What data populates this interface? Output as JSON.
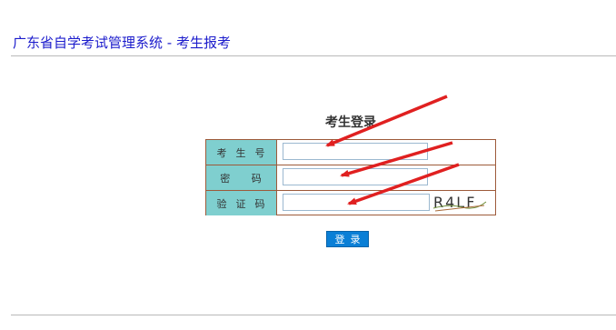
{
  "header": {
    "title": "广东省自学考试管理系统 - 考生报考"
  },
  "login": {
    "heading": "考生登录",
    "fields": [
      {
        "label": "考  生  号",
        "value": "",
        "placeholder": ""
      },
      {
        "label": "密     码",
        "value": "",
        "placeholder": ""
      },
      {
        "label": "验  证  码",
        "value": "",
        "placeholder": ""
      }
    ],
    "captcha_text": "R4LF",
    "submit_label": "登录"
  },
  "colors": {
    "title": "#1c1ccc",
    "label_bg": "#7fcfcf",
    "table_border": "#9d5a3a",
    "button_bg": "#0a7fd6",
    "annotation_arrow": "#e02020"
  }
}
